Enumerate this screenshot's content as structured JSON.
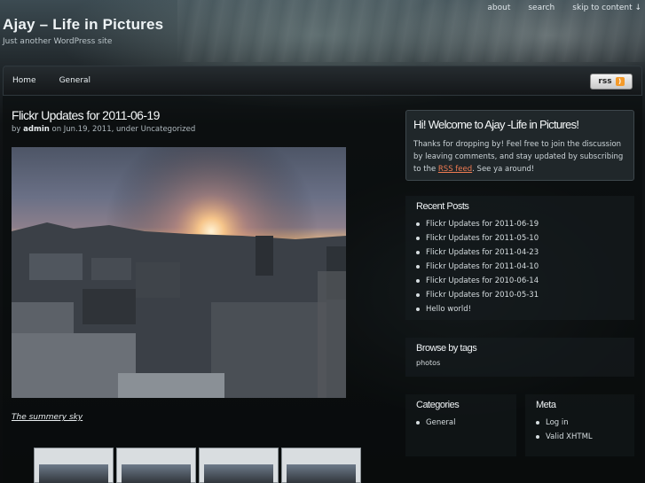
{
  "header": {
    "site_title": "Ajay – Life in Pictures",
    "tagline": "Just another WordPress site",
    "top_links": [
      "about",
      "search",
      "skip to content ↓"
    ]
  },
  "nav": {
    "items": [
      "Home",
      "General"
    ],
    "rss_label": "rss"
  },
  "post": {
    "title": "Flickr Updates for 2011-06-19",
    "meta_prefix": "by",
    "author": "admin",
    "meta_on": "on Jun.19, 2011, under Uncategorized",
    "caption": "The summery sky"
  },
  "sidebar": {
    "welcome_title": "Hi! Welcome to Ajay -Life in Pictures!",
    "welcome_text_1": "Thanks for dropping by! Feel free to join the discussion by leaving comments, and stay updated by subscribing to the",
    "welcome_link": "RSS feed",
    "welcome_text_2": ". See ya around!",
    "recent_posts_title": "Recent Posts",
    "recent_posts": [
      "Flickr Updates for 2011-06-19",
      "Flickr Updates for 2011-05-10",
      "Flickr Updates for 2011-04-23",
      "Flickr Updates for 2011-04-10",
      "Flickr Updates for 2010-06-14",
      "Flickr Updates for 2010-05-31",
      "Hello world!"
    ],
    "tags_title": "Browse by tags",
    "tags": "photos",
    "categories_title": "Categories",
    "categories": [
      "General"
    ],
    "meta_title": "Meta",
    "meta_items": [
      "Log in",
      "Valid XHTML"
    ]
  }
}
